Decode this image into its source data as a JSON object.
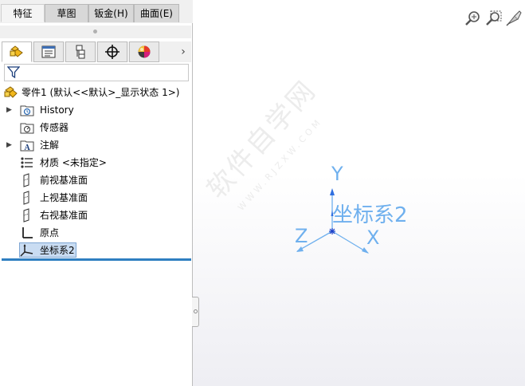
{
  "command_manager": {
    "tabs": [
      "特征",
      "草图",
      "钣金(H)",
      "曲面(E)"
    ],
    "active_tab": "特征"
  },
  "panel_tabs": [
    {
      "name": "featuremanager-tree",
      "icon": "feature-tree-icon"
    },
    {
      "name": "propertymanager",
      "icon": "property-list-icon"
    },
    {
      "name": "configurationmanager",
      "icon": "configuration-icon"
    },
    {
      "name": "dimxpertmanager",
      "icon": "crosshair-target-icon"
    },
    {
      "name": "displaymanager",
      "icon": "appearance-sphere-icon"
    }
  ],
  "tree": {
    "root": "零件1  (默认<<默认>_显示状态 1>)",
    "items": [
      {
        "label": "History",
        "icon": "history-folder-icon",
        "expandable": true
      },
      {
        "label": "传感器",
        "icon": "sensor-folder-icon",
        "expandable": false
      },
      {
        "label": "注解",
        "icon": "annotation-folder-icon",
        "expandable": true
      },
      {
        "label": "材质 <未指定>",
        "icon": "material-icon",
        "expandable": false
      },
      {
        "label": "前视基准面",
        "icon": "plane-icon",
        "expandable": false
      },
      {
        "label": "上视基准面",
        "icon": "plane-icon",
        "expandable": false
      },
      {
        "label": "右视基准面",
        "icon": "plane-icon",
        "expandable": false
      },
      {
        "label": "原点",
        "icon": "origin-icon",
        "expandable": false
      },
      {
        "label": "坐标系2",
        "icon": "coordinate-system-icon",
        "expandable": false,
        "selected": true
      }
    ]
  },
  "graphics": {
    "coordinate_system_label": "坐标系2",
    "axes": {
      "x": "X",
      "y": "Y",
      "z": "Z"
    },
    "view_buttons": [
      "zoom-to-fit-icon",
      "zoom-to-area-icon",
      "previous-view-icon"
    ],
    "watermark": "软件自学网",
    "watermark_sub": "WWW.RJZXW.COM"
  },
  "colors": {
    "axis_blue": "#6fb0ee",
    "selection_bg": "#c9dcf2",
    "rollback_bar": "#2f7fc1"
  }
}
